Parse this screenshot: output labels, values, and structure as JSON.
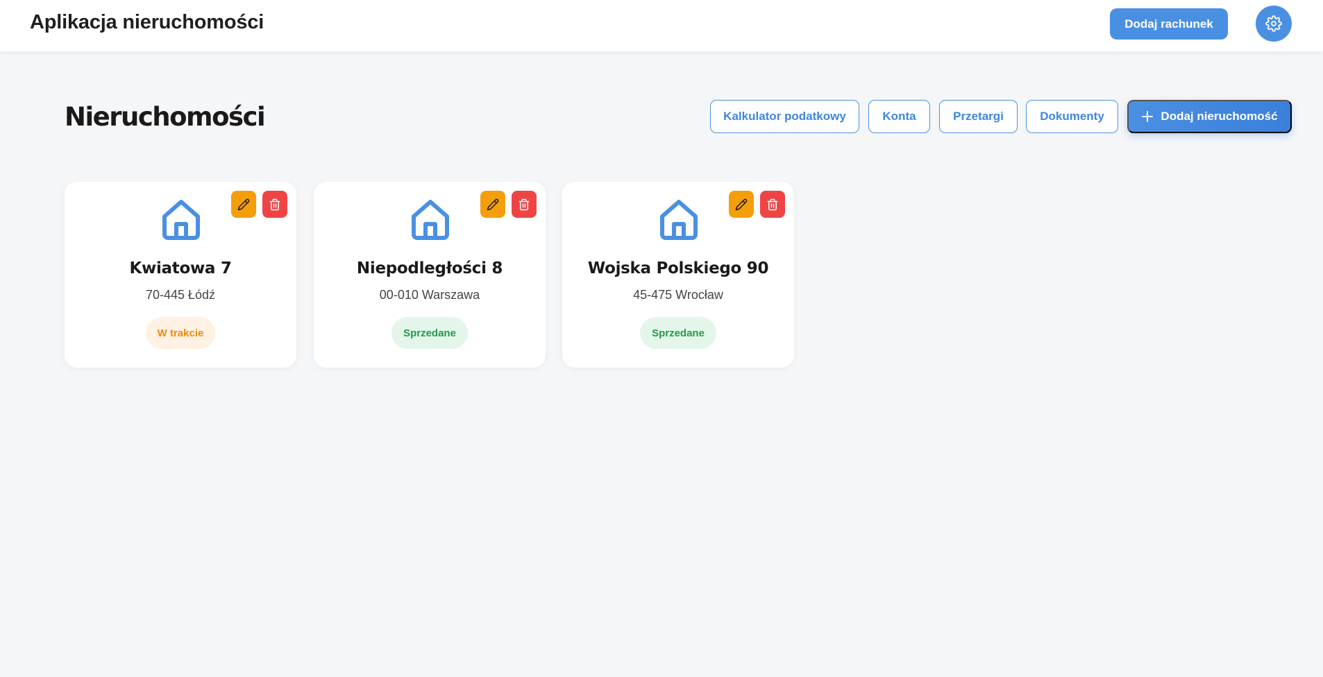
{
  "header": {
    "title": "Aplikacja nieruchomości",
    "add_bill_label": "Dodaj rachunek",
    "settings_icon": "gear-icon"
  },
  "page": {
    "title": "Nieruchomości"
  },
  "nav": {
    "tax_calculator": "Kalkulator podatkowy",
    "accounts": "Konta",
    "tenders": "Przetargi",
    "documents": "Dokumenty",
    "add_property": "Dodaj nieruchomość"
  },
  "properties": [
    {
      "name": "Kwiatowa 7",
      "address": "70-445 Łódź",
      "status": "W trakcie",
      "status_type": "in-progress"
    },
    {
      "name": "Niepodległości 8",
      "address": "00-010 Warszawa",
      "status": "Sprzedane",
      "status_type": "sold"
    },
    {
      "name": "Wojska Polskiego 90",
      "address": "45-475 Wrocław",
      "status": "Sprzedane",
      "status_type": "sold"
    }
  ],
  "colors": {
    "accent": "#4a90e2",
    "edit": "#f59e0b",
    "delete": "#ef4444",
    "in_progress_text": "#f08a00",
    "sold_text": "#229a4c"
  }
}
